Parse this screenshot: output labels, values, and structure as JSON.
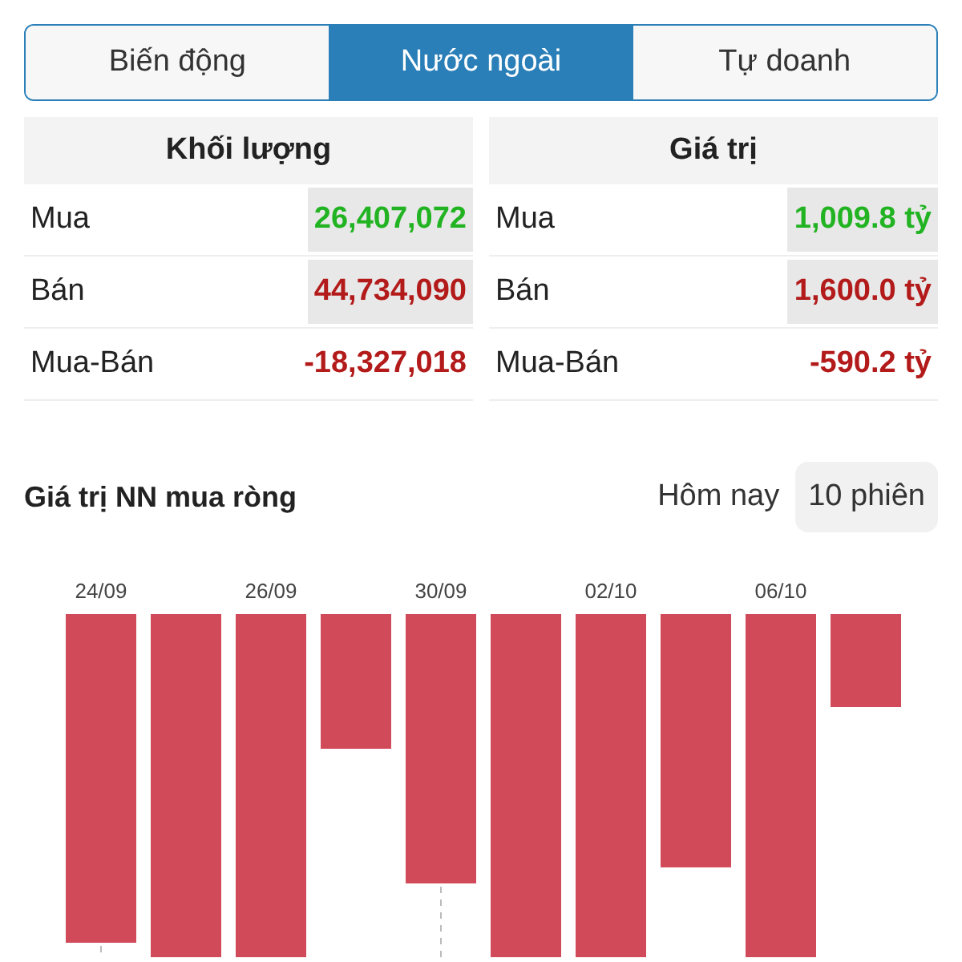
{
  "tabs": [
    {
      "label": "Biến động",
      "selected": false
    },
    {
      "label": "Nước ngoài",
      "selected": true
    },
    {
      "label": "Tự doanh",
      "selected": false
    }
  ],
  "tables": [
    {
      "title": "Khối lượng",
      "rows": [
        {
          "label": "Mua",
          "value": "26,407,072",
          "color": "#22b322",
          "highlighted": true
        },
        {
          "label": "Bán",
          "value": "44,734,090",
          "color": "#b31b1b",
          "highlighted": true
        },
        {
          "label": "Mua-Bán",
          "value": "-18,327,018",
          "color": "#b31b1b",
          "highlighted": false
        }
      ]
    },
    {
      "title": "Giá trị",
      "rows": [
        {
          "label": "Mua",
          "value": "1,009.8 tỷ",
          "color": "#22b322",
          "highlighted": true
        },
        {
          "label": "Bán",
          "value": "1,600.0 tỷ",
          "color": "#b31b1b",
          "highlighted": true
        },
        {
          "label": "Mua-Bán",
          "value": "-590.2 tỷ",
          "color": "#b31b1b",
          "highlighted": false
        }
      ]
    }
  ],
  "chart": {
    "title": "Giá trị NN mua ròng",
    "periods": [
      {
        "label": "Hôm nay",
        "selected": false
      },
      {
        "label": "10 phiên",
        "selected": true
      }
    ],
    "date_labels": [
      "24/09",
      "26/09",
      "30/09",
      "02/10",
      "06/10"
    ]
  }
}
